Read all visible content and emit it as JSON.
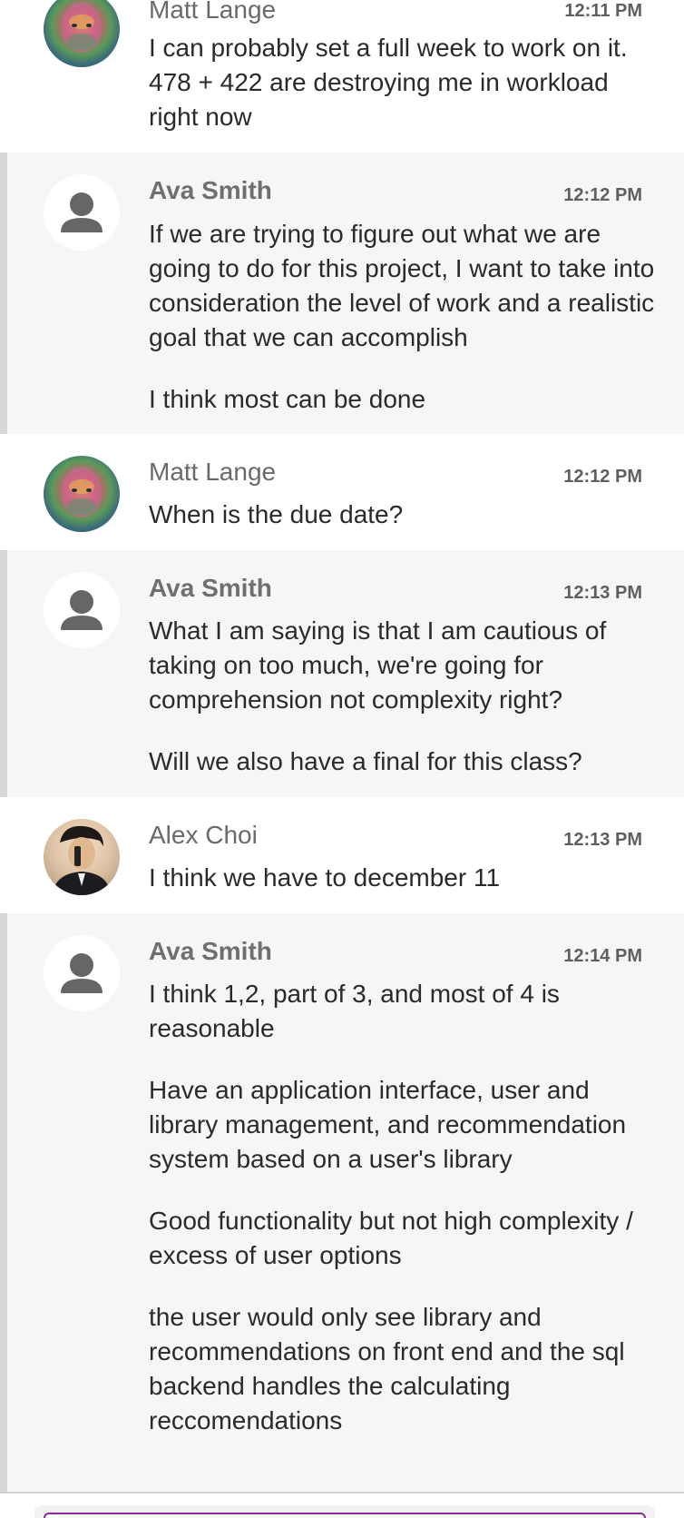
{
  "messages": [
    {
      "sender": "Matt Lange",
      "time": "12:11 PM",
      "avatar": "matt-lange-avatar",
      "paragraphs": [
        "I can probably set a full week to work on it. 478 + 422 are destroying me in workload right now"
      ]
    },
    {
      "sender": "Ava Smith",
      "time": "12:12 PM",
      "avatar": "default-user-avatar",
      "paragraphs": [
        "If we are trying to figure out what we are going to do for this project, I want to take into consideration the level of work and a realistic goal that we can accomplish",
        "I think most can be done"
      ]
    },
    {
      "sender": "Matt Lange",
      "time": "12:12 PM",
      "avatar": "matt-lange-avatar",
      "paragraphs": [
        "When is the due date?"
      ]
    },
    {
      "sender": "Ava Smith",
      "time": "12:13 PM",
      "avatar": "default-user-avatar",
      "paragraphs": [
        "What I am saying is that I am cautious of taking on too much, we're going for comprehension not complexity right?",
        "Will we also have a final for this class?"
      ]
    },
    {
      "sender": "Alex Choi",
      "time": "12:13 PM",
      "avatar": "alex-choi-avatar",
      "paragraphs": [
        "I think we have to december 11"
      ]
    },
    {
      "sender": "Ava Smith",
      "time": "12:14 PM",
      "avatar": "default-user-avatar",
      "paragraphs": [
        "I think 1,2, part of 3, and most of 4 is reasonable",
        "Have an application interface, user and library management, and recommendation system based on a user's library",
        "Good functionality but not high complexity / excess of user options",
        "the user would only see library and recommendations on front end and the sql backend handles the calculating reccomendations"
      ]
    }
  ],
  "colors": {
    "self_background": "#f6f6f6",
    "self_border": "#d8d8d8",
    "composer_border": "#8a2b9a"
  }
}
